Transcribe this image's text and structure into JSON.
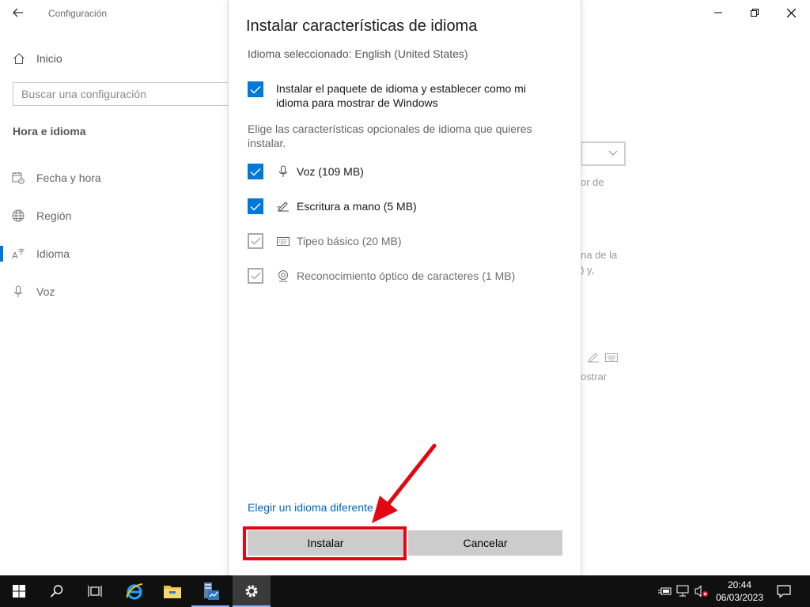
{
  "settings": {
    "app_title": "Configuración",
    "home_label": "Inicio",
    "search_placeholder": "Buscar una configuración",
    "section_title": "Hora e idioma",
    "nav_items": [
      {
        "label": "Fecha y hora",
        "icon": "calendar-clock-icon"
      },
      {
        "label": "Región",
        "icon": "globe-icon"
      },
      {
        "label": "Idioma",
        "icon": "language-icon",
        "active": true
      },
      {
        "label": "Voz",
        "icon": "microphone-icon"
      }
    ],
    "bg_text_1": "or de",
    "bg_text_2": "na de la",
    "bg_text_3": ") y,",
    "bg_text_4": "ostrar"
  },
  "dialog": {
    "title": "Instalar características de idioma",
    "selected_language": "Idioma seleccionado: English (United States)",
    "install_pack_label": "Instalar el paquete de idioma y establecer como mi idioma para mostrar de Windows",
    "optional_desc": "Elige las características opcionales de idioma que quieres instalar.",
    "features": [
      {
        "label": "Voz (109 MB)",
        "checked": true,
        "enabled": true,
        "icon": "microphone-icon"
      },
      {
        "label": "Escritura a mano (5 MB)",
        "checked": true,
        "enabled": true,
        "icon": "handwriting-icon"
      },
      {
        "label": "Tipeo básico (20 MB)",
        "checked": true,
        "enabled": false,
        "icon": "keyboard-icon"
      },
      {
        "label": "Reconocimiento óptico de caracteres (1 MB)",
        "checked": true,
        "enabled": false,
        "icon": "ocr-icon"
      }
    ],
    "link_label": "Elegir un idioma diferente",
    "install_label": "Instalar",
    "cancel_label": "Cancelar"
  },
  "taskbar": {
    "time": "20:44",
    "date": "06/03/2023"
  },
  "colors": {
    "accent": "#0078d7",
    "link": "#0067b8",
    "highlight": "#e30613",
    "taskbar": "#101010"
  }
}
